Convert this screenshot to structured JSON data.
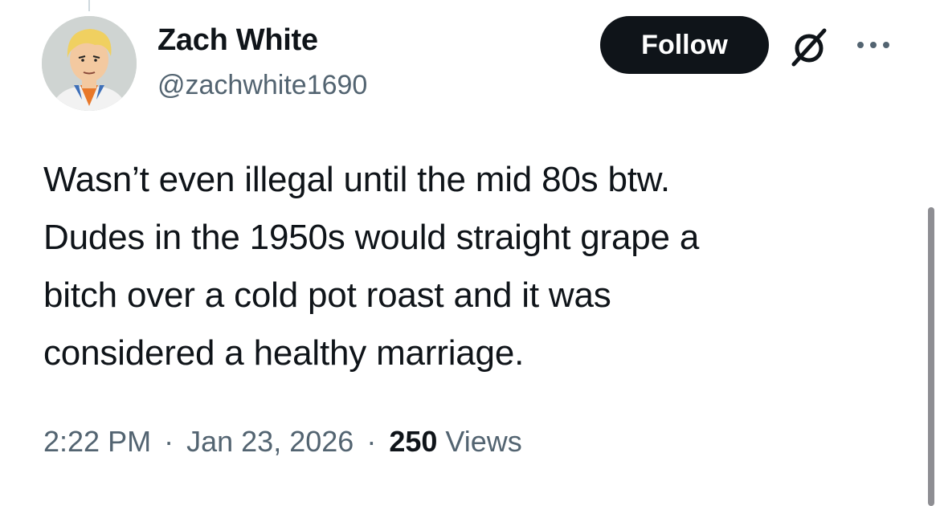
{
  "author": {
    "display_name": "Zach White",
    "handle": "@zachwhite1690",
    "avatar_icon": "cartoon-avatar"
  },
  "actions": {
    "follow_label": "Follow",
    "grok_icon": "grok-icon",
    "more_icon": "more-icon"
  },
  "tweet": {
    "text_lines": [
      "Wasn’t even illegal until the mid 80s btw.",
      "Dudes in the 1950s would straight grape a",
      "bitch over a cold pot roast and it was",
      "considered a healthy marriage."
    ]
  },
  "meta": {
    "time": "2:22 PM",
    "separator": "·",
    "date": "Jan 23, 2026",
    "views_count": "250",
    "views_label": "Views"
  },
  "colors": {
    "primary_text": "#0f1419",
    "secondary_text": "#536471",
    "follow_button_bg": "#0f1419",
    "follow_button_text": "#ffffff",
    "background": "#ffffff"
  }
}
